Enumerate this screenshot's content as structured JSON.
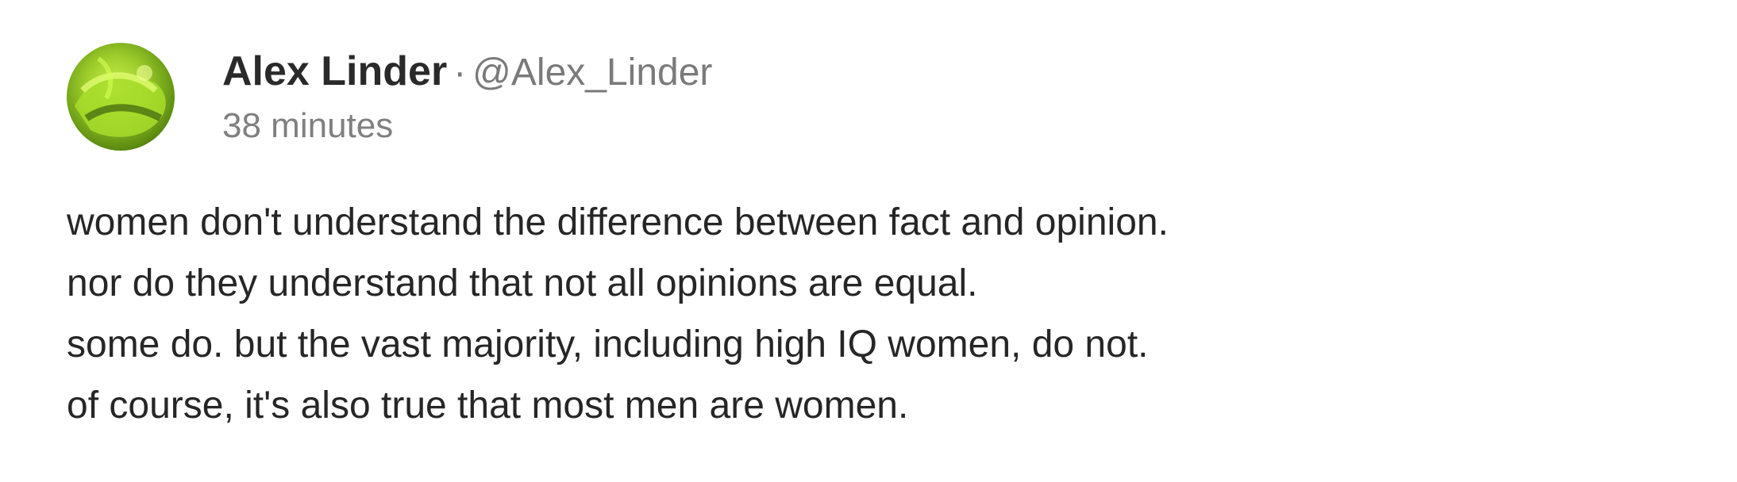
{
  "post": {
    "author_name": "Alex Linder",
    "separator": "·",
    "handle": "@Alex_Linder",
    "timestamp": "38 minutes",
    "avatar_icon": "avatar-image",
    "lines": [
      "women don't understand the difference between fact and opinion.",
      "nor do they understand that not all opinions are equal.",
      "some do. but the vast majority, including high IQ women, do not.",
      "of course, it's also true that most men are women."
    ]
  }
}
